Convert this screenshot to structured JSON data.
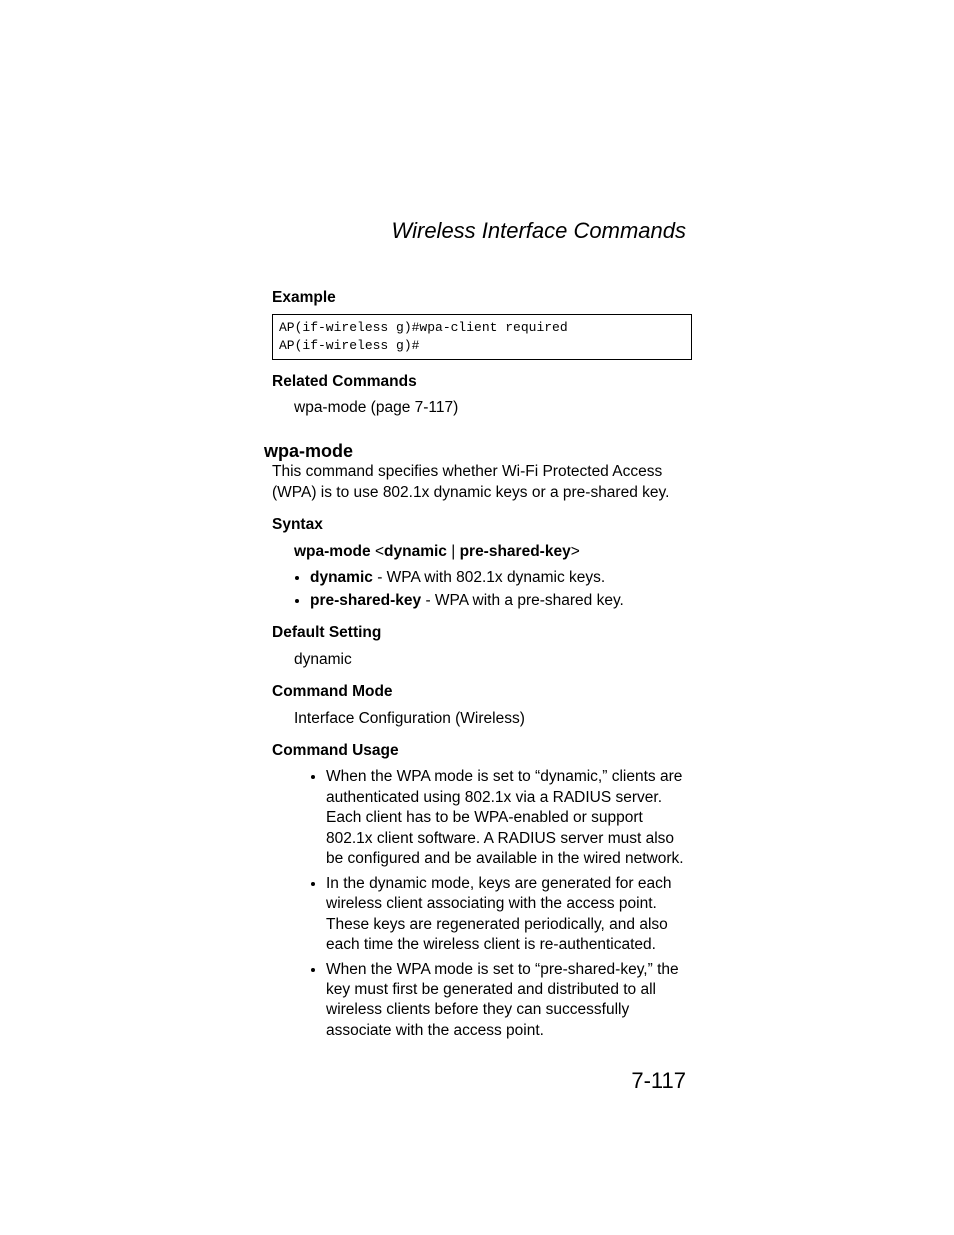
{
  "header": {
    "section_title": "Wireless Interface Commands"
  },
  "section_example": {
    "heading": "Example",
    "code": "AP(if-wireless g)#wpa-client required\nAP(if-wireless g)#"
  },
  "section_related": {
    "heading": "Related Commands",
    "text": "wpa-mode (page 7-117)"
  },
  "command": {
    "name": "wpa-mode",
    "description": "This command specifies whether Wi-Fi Protected Access (WPA) is to use 802.1x dynamic keys or a pre-shared key."
  },
  "syntax": {
    "heading": "Syntax",
    "line_prefix": "wpa-mode",
    "lt": "<",
    "opt1": "dynamic",
    "pipe": " | ",
    "opt2": "pre-shared-key",
    "gt": ">",
    "bullets": [
      {
        "term": "dynamic",
        "desc": " - WPA with 802.1x dynamic keys."
      },
      {
        "term": "pre-shared-key",
        "desc": " - WPA with a pre-shared key."
      }
    ]
  },
  "default_setting": {
    "heading": "Default Setting",
    "value": "dynamic"
  },
  "command_mode": {
    "heading": "Command Mode",
    "value": "Interface Configuration (Wireless)"
  },
  "command_usage": {
    "heading": "Command Usage",
    "bullets": [
      "When the WPA mode is set to “dynamic,” clients are authenticated using 802.1x via a RADIUS server. Each client has to be WPA-enabled or support 802.1x client software. A RADIUS server must also be configured and be available in the wired network.",
      "In the dynamic mode, keys are generated for each wireless client associating with the access point. These keys are regenerated periodically, and also each time the wireless client is re-authenticated.",
      "When the WPA mode is set to “pre-shared-key,” the key must first be generated and distributed to all wireless clients before they can successfully associate with the access point."
    ]
  },
  "page_number": "7-117"
}
